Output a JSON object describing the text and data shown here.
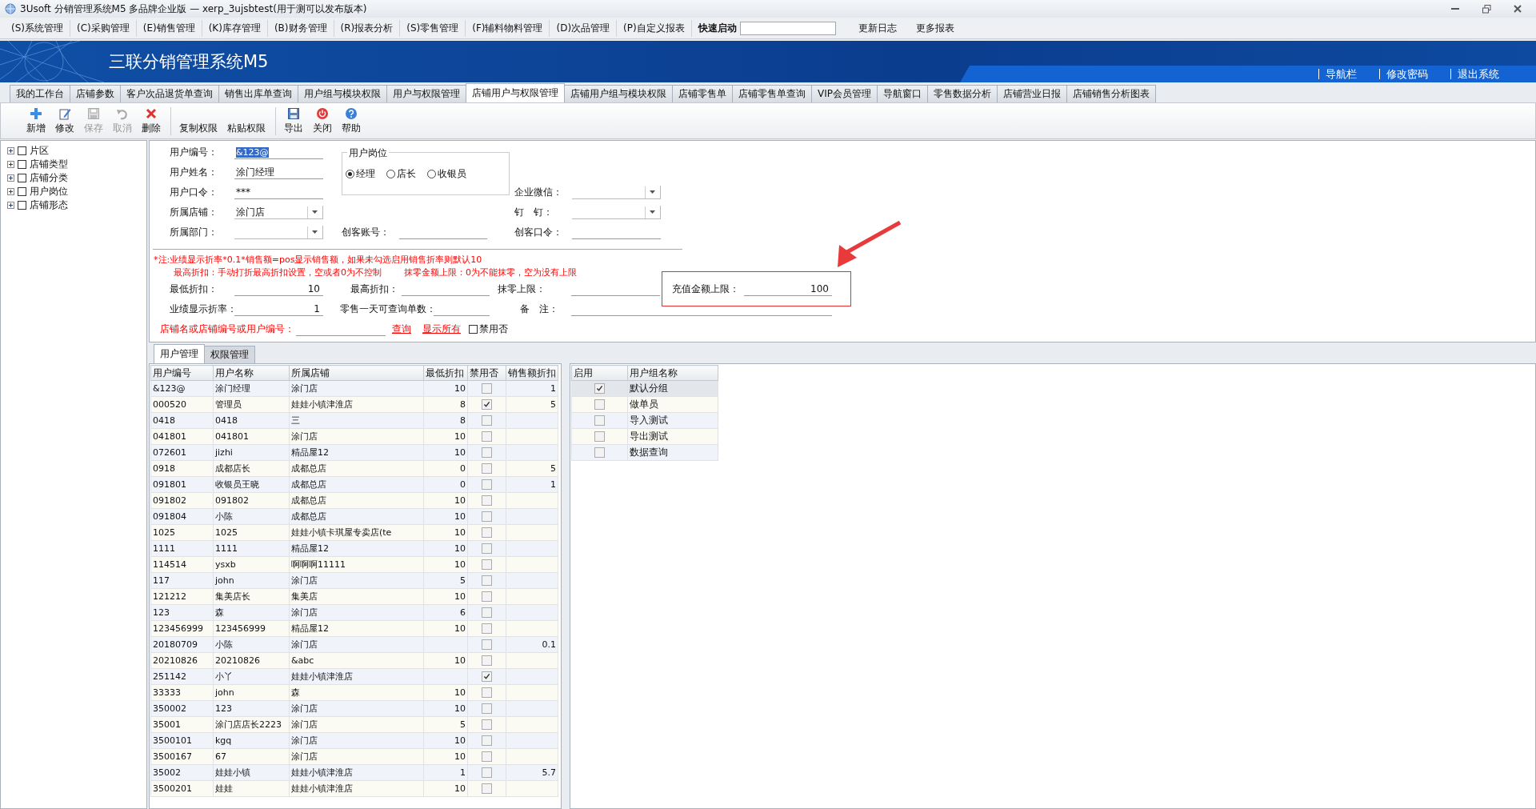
{
  "window": {
    "title": "3Usoft 分销管理系统M5 多品牌企业版 — xerp_3ujsbtest(用于测可以发布版本)"
  },
  "menu": [
    "(S)系统管理",
    "(C)采购管理",
    "(E)销售管理",
    "(K)库存管理",
    "(B)财务管理",
    "(R)报表分析",
    "(S)零售管理",
    "(F)辅料物料管理",
    "(D)次品管理",
    "(P)自定义报表"
  ],
  "quick_launch": {
    "label": "快速启动"
  },
  "menu_extra": [
    "更新日志",
    "更多报表"
  ],
  "banner": {
    "title": "三联分销管理系统M5",
    "links": [
      "导航栏",
      "修改密码",
      "退出系统"
    ]
  },
  "tabs": [
    {
      "label": "我的工作台",
      "selected": false
    },
    {
      "label": "店铺参数",
      "selected": false
    },
    {
      "label": "客户次品退货单查询",
      "selected": false
    },
    {
      "label": "销售出库单查询",
      "selected": false
    },
    {
      "label": "用户组与模块权限",
      "selected": false
    },
    {
      "label": "用户与权限管理",
      "selected": false
    },
    {
      "label": "店铺用户与权限管理",
      "selected": true
    },
    {
      "label": "店铺用户组与模块权限",
      "selected": false
    },
    {
      "label": "店铺零售单",
      "selected": false
    },
    {
      "label": "店铺零售单查询",
      "selected": false
    },
    {
      "label": "VIP会员管理",
      "selected": false
    },
    {
      "label": "导航窗口",
      "selected": false
    },
    {
      "label": "零售数据分析",
      "selected": false
    },
    {
      "label": "店铺营业日报",
      "selected": false
    },
    {
      "label": "店铺销售分析图表",
      "selected": false
    }
  ],
  "toolbar": [
    {
      "label": "新增",
      "kind": "add",
      "disabled": false
    },
    {
      "label": "修改",
      "kind": "edit",
      "disabled": false
    },
    {
      "label": "保存",
      "kind": "save",
      "disabled": true
    },
    {
      "label": "取消",
      "kind": "cancel",
      "disabled": true
    },
    {
      "label": "删除",
      "kind": "delete",
      "disabled": false
    },
    {
      "label": "复制权限",
      "kind": "text",
      "disabled": false
    },
    {
      "label": "粘贴权限",
      "kind": "text",
      "disabled": false
    },
    {
      "label": "导出",
      "kind": "export",
      "disabled": false
    },
    {
      "label": "关闭",
      "kind": "close",
      "disabled": false
    },
    {
      "label": "帮助",
      "kind": "help",
      "disabled": false
    }
  ],
  "tree": [
    {
      "label": "片区",
      "expanded": false,
      "checked": false
    },
    {
      "label": "店铺类型",
      "expanded": false,
      "checked": false
    },
    {
      "label": "店铺分类",
      "expanded": false,
      "checked": false
    },
    {
      "label": "用户岗位",
      "expanded": false,
      "checked": false
    },
    {
      "label": "店铺形态",
      "expanded": false,
      "checked": false
    }
  ],
  "form": {
    "user_id": {
      "label": "用户编号：",
      "value": "&123@"
    },
    "user_name": {
      "label": "用户姓名：",
      "value": "涂门经理"
    },
    "password": {
      "label": "用户口令：",
      "value": "***"
    },
    "store": {
      "label": "所属店铺：",
      "value": "涂门店"
    },
    "department": {
      "label": "所属部门："
    },
    "position": {
      "title": "用户岗位",
      "options": [
        {
          "label": "经理",
          "selected": true
        },
        {
          "label": "店长",
          "selected": false
        },
        {
          "label": "收银员",
          "selected": false
        }
      ]
    },
    "maker_account": {
      "label": "创客账号："
    },
    "wecom": {
      "label": "企业微信："
    },
    "dingtalk": {
      "label": "钉　钉："
    },
    "maker_password": {
      "label": "创客口令："
    },
    "notes": [
      "*注:业绩显示折率*0.1*销售额=pos显示销售额，如果未勾选启用销售折率则默认10",
      "最高折扣：手动打折最高折扣设置，空或者0为不控制",
      "抹零金额上限：0为不能抹零，空为没有上限"
    ],
    "min_discount": {
      "label": "最低折扣：",
      "value": "10"
    },
    "max_discount": {
      "label": "最高折扣："
    },
    "rounding_limit": {
      "label": "抹零上限："
    },
    "recharge_limit": {
      "label": "充值金额上限：",
      "value": "100"
    },
    "display_rate": {
      "label": "业绩显示折率：",
      "value": "1"
    },
    "query_count": {
      "label": "零售一天可查询单数："
    },
    "remark": {
      "label": "备　注："
    },
    "search": {
      "label": "店铺名或店铺编号或用户编号：",
      "query_link": "查询",
      "show_all_link": "显示所有",
      "disabled_filter": {
        "label": "禁用否",
        "checked": false
      }
    }
  },
  "subtabs": [
    {
      "label": "用户管理",
      "selected": true
    },
    {
      "label": "权限管理",
      "selected": false
    }
  ],
  "users_table": {
    "columns": [
      "用户编号",
      "用户名称",
      "所属店铺",
      "最低折扣",
      "禁用否",
      "销售额折扣"
    ],
    "rows": [
      {
        "id": "&123@",
        "name": "涂门经理",
        "store": "涂门店",
        "min_discount": "10",
        "banned": false,
        "sales_discount": "1"
      },
      {
        "id": "000520",
        "name": "管理员",
        "store": "娃娃小镇津淮店",
        "min_discount": "8",
        "banned": true,
        "sales_discount": "5"
      },
      {
        "id": "0418",
        "name": "0418",
        "store": "三",
        "min_discount": "8",
        "banned": false
      },
      {
        "id": "041801",
        "name": "041801",
        "store": "涂门店",
        "min_discount": "10",
        "banned": false
      },
      {
        "id": "072601",
        "name": "jizhi",
        "store": "精品屋12",
        "min_discount": "10",
        "banned": false
      },
      {
        "id": "0918",
        "name": "成都店长",
        "store": "成都总店",
        "min_discount": "0",
        "banned": false,
        "sales_discount": "5"
      },
      {
        "id": "091801",
        "name": "收银员王晓",
        "store": "成都总店",
        "min_discount": "0",
        "banned": false,
        "sales_discount": "1"
      },
      {
        "id": "091802",
        "name": "091802",
        "store": "成都总店",
        "min_discount": "10",
        "banned": false
      },
      {
        "id": "091804",
        "name": "小陈",
        "store": "成都总店",
        "min_discount": "10",
        "banned": false
      },
      {
        "id": "1025",
        "name": "1025",
        "store": "娃娃小镇卡琪屋专卖店(te",
        "min_discount": "10",
        "banned": false
      },
      {
        "id": "1111",
        "name": "1111",
        "store": "精品屋12",
        "min_discount": "10",
        "banned": false
      },
      {
        "id": "114514",
        "name": "ysxb",
        "store": "啊啊啊11111",
        "min_discount": "10",
        "banned": false
      },
      {
        "id": "117",
        "name": "john",
        "store": "涂门店",
        "min_discount": "5",
        "banned": false
      },
      {
        "id": "121212",
        "name": "集美店长",
        "store": "集美店",
        "min_discount": "10",
        "banned": false
      },
      {
        "id": "123",
        "name": "森",
        "store": "涂门店",
        "min_discount": "6",
        "banned": false
      },
      {
        "id": "123456999",
        "name": "123456999",
        "store": "精品屋12",
        "min_discount": "10",
        "banned": false
      },
      {
        "id": "20180709",
        "name": "小陈",
        "store": "涂门店",
        "banned": false,
        "sales_discount": "0.1"
      },
      {
        "id": "20210826",
        "name": "20210826",
        "store": "&abc",
        "min_discount": "10",
        "banned": false
      },
      {
        "id": "251142",
        "name": "小丫",
        "store": "娃娃小镇津淮店",
        "banned": true
      },
      {
        "id": "33333",
        "name": "john",
        "store": "森",
        "min_discount": "10",
        "banned": false
      },
      {
        "id": "350002",
        "name": "123",
        "store": "涂门店",
        "min_discount": "10",
        "banned": false
      },
      {
        "id": "35001",
        "name": "涂门店店长2223",
        "store": "涂门店",
        "min_discount": "5",
        "banned": false
      },
      {
        "id": "3500101",
        "name": "kgq",
        "store": "涂门店",
        "min_discount": "10",
        "banned": false
      },
      {
        "id": "3500167",
        "name": "67",
        "store": "涂门店",
        "min_discount": "10",
        "banned": false
      },
      {
        "id": "35002",
        "name": "娃娃小镇",
        "store": "娃娃小镇津淮店",
        "min_discount": "1",
        "banned": false,
        "sales_discount": "5.7"
      },
      {
        "id": "3500201",
        "name": "娃娃",
        "store": "娃娃小镇津淮店",
        "min_discount": "10",
        "banned": false
      }
    ]
  },
  "groups_table": {
    "columns": [
      "启用",
      "用户组名称"
    ],
    "rows": [
      {
        "enabled": true,
        "name": "默认分组",
        "selected": true
      },
      {
        "enabled": false,
        "name": "做单员",
        "selected": false
      },
      {
        "enabled": false,
        "name": "导入测试",
        "selected": false
      },
      {
        "enabled": false,
        "name": "导出测试",
        "selected": false
      },
      {
        "enabled": false,
        "name": "数据查询",
        "selected": false
      }
    ]
  }
}
